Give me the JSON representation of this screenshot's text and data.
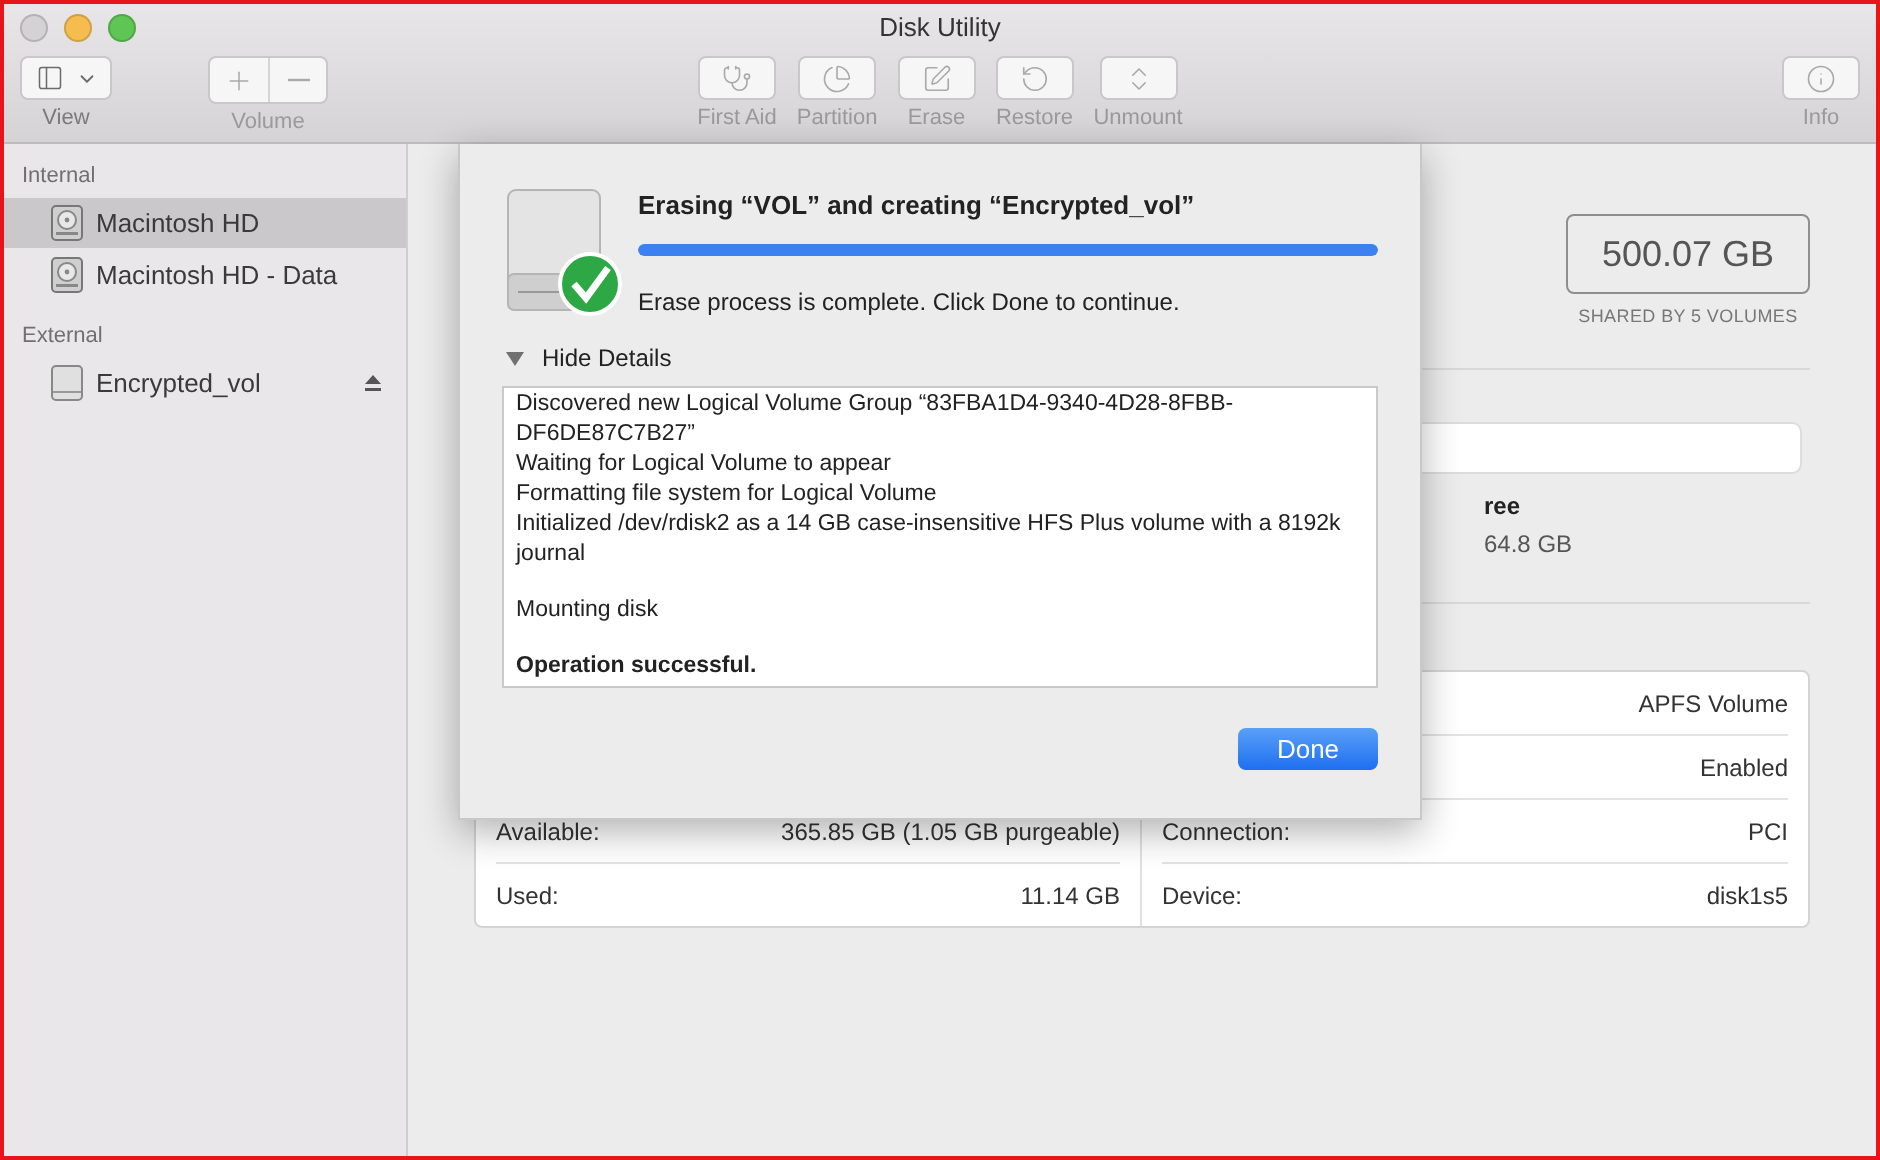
{
  "window": {
    "title": "Disk Utility"
  },
  "toolbar": {
    "left": [
      {
        "label": "View",
        "disabled": false
      },
      {
        "label": "Volume",
        "disabled": true
      }
    ],
    "center": [
      {
        "label": "First Aid",
        "disabled": true
      },
      {
        "label": "Partition",
        "disabled": true
      },
      {
        "label": "Erase",
        "disabled": true
      },
      {
        "label": "Restore",
        "disabled": true
      },
      {
        "label": "Unmount",
        "disabled": true
      }
    ],
    "right": [
      {
        "label": "Info",
        "disabled": true
      }
    ]
  },
  "sidebar": {
    "groups": [
      {
        "title": "Internal",
        "items": [
          {
            "name": "Macintosh HD",
            "kind": "internal",
            "selected": true,
            "ejectable": false
          },
          {
            "name": "Macintosh HD - Data",
            "kind": "internal",
            "selected": false,
            "ejectable": false
          }
        ]
      },
      {
        "title": "External",
        "items": [
          {
            "name": "Encrypted_vol",
            "kind": "external",
            "selected": false,
            "ejectable": true
          }
        ]
      }
    ]
  },
  "capacity": {
    "value": "500.07 GB",
    "caption": "SHARED BY 5 VOLUMES"
  },
  "usage_legend": {
    "label": "ree",
    "value": "64.8 GB"
  },
  "info": {
    "left": [
      {
        "label": "Available:",
        "value": "365.85 GB (1.05 GB purgeable)"
      },
      {
        "label": "Used:",
        "value": "11.14 GB"
      }
    ],
    "right": [
      {
        "value": "APFS Volume"
      },
      {
        "value": "Enabled"
      },
      {
        "label": "Connection:",
        "value": "PCI"
      },
      {
        "label": "Device:",
        "value": "disk1s5"
      }
    ]
  },
  "sheet": {
    "title": "Erasing “VOL” and creating “Encrypted_vol”",
    "progress": {
      "level": 1
    },
    "status": "Erase process is complete. Click Done to continue.",
    "details_toggle": {
      "label": "Hide Details",
      "expanded": true
    },
    "log": [
      {
        "lines": [
          {
            "text": "Discovered new Logical Volume Group “83FBA1D4-9340-4D28-8FBB-DF6DE87C7B27”",
            "bold": false
          },
          {
            "text": "Waiting for Logical Volume to appear",
            "bold": false
          },
          {
            "text": "Formatting file system for Logical Volume",
            "bold": false
          },
          {
            "text": "Initialized /dev/rdisk2 as a 14 GB case-insensitive HFS Plus volume with a 8192k journal",
            "bold": false
          }
        ]
      },
      {
        "lines": [
          {
            "text": "Mounting disk",
            "bold": false
          }
        ]
      },
      {
        "lines": [
          {
            "text": "Operation successful.",
            "bold": true
          }
        ]
      }
    ],
    "done_button": "Done"
  }
}
